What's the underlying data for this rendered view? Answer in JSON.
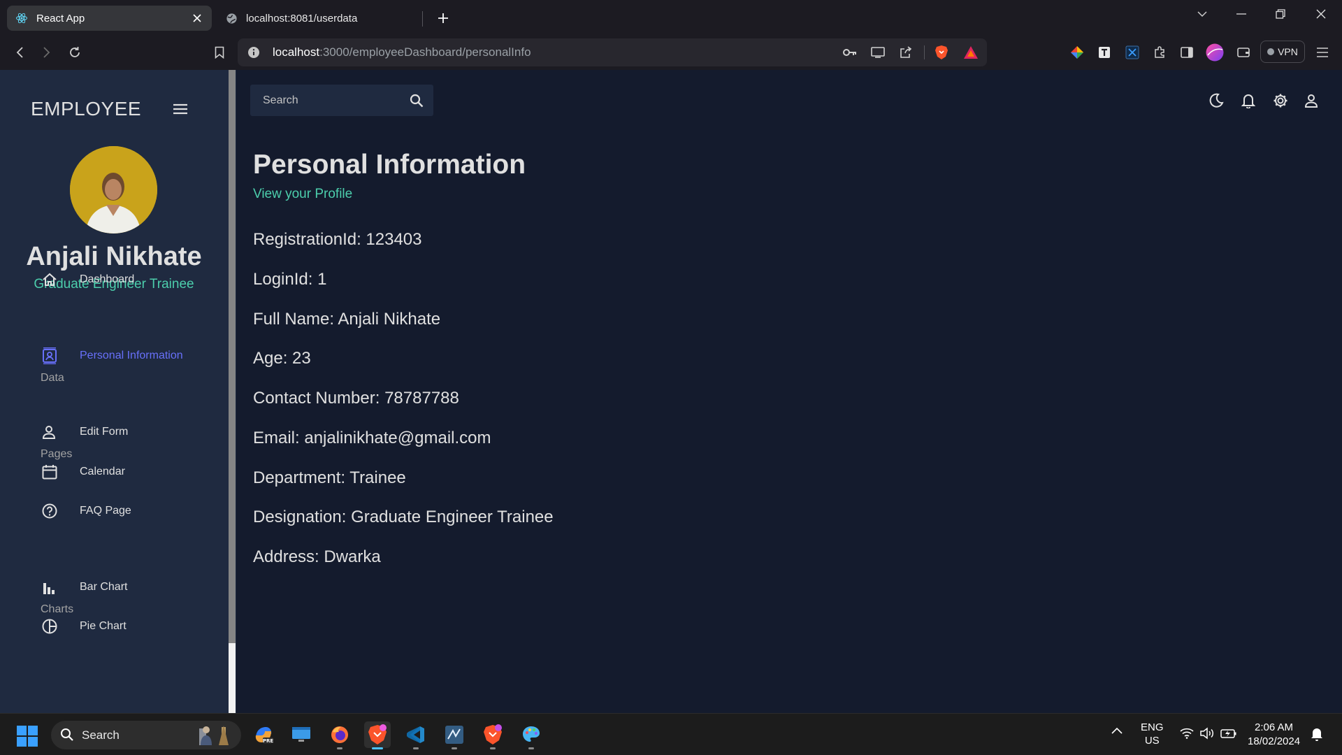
{
  "browser": {
    "tabs": [
      {
        "title": "React App",
        "active": true,
        "icon": "react-icon"
      },
      {
        "title": "localhost:8081/userdata",
        "active": false,
        "icon": "globe-icon"
      }
    ],
    "url_host": "localhost",
    "url_path": ":3000/employeeDashboard/personalInfo",
    "vpn_label": "VPN"
  },
  "sidebar": {
    "brand": "EMPLOYEE",
    "profile_name": "Anjali Nikhate",
    "profile_role": "Graduate Engineer Trainee",
    "items": [
      {
        "label": "Dashboard",
        "icon": "home-icon"
      },
      {
        "label": "Personal Information",
        "icon": "contacts-icon",
        "active": true
      },
      {
        "label": "Edit Form",
        "icon": "person-icon"
      },
      {
        "label": "Calendar",
        "icon": "calendar-icon"
      },
      {
        "label": "FAQ Page",
        "icon": "help-icon"
      },
      {
        "label": "Bar Chart",
        "icon": "bar-chart-icon"
      },
      {
        "label": "Pie Chart",
        "icon": "pie-chart-icon"
      }
    ],
    "sections": [
      "Data",
      "Pages",
      "Charts"
    ]
  },
  "topbar": {
    "search_placeholder": "Search"
  },
  "main": {
    "title": "Personal Information",
    "subtitle": "View your Profile",
    "fields": [
      "RegistrationId: 123403",
      "LoginId: 1",
      "Full Name: Anjali Nikhate",
      "Age: 23",
      "Contact Number: 78787788",
      "Email: anjalinikhate@gmail.com",
      "Department: Trainee",
      "Designation: Graduate Engineer Trainee",
      "Address: Dwarka"
    ]
  },
  "taskbar": {
    "search_label": "Search",
    "lang_line1": "ENG",
    "lang_line2": "US",
    "time": "2:06 AM",
    "date": "18/02/2024"
  },
  "colors": {
    "accent_green": "#4cceac",
    "active_nav": "#6870fa",
    "sidebar_bg": "#1f2a40",
    "main_bg": "#141b2d"
  }
}
